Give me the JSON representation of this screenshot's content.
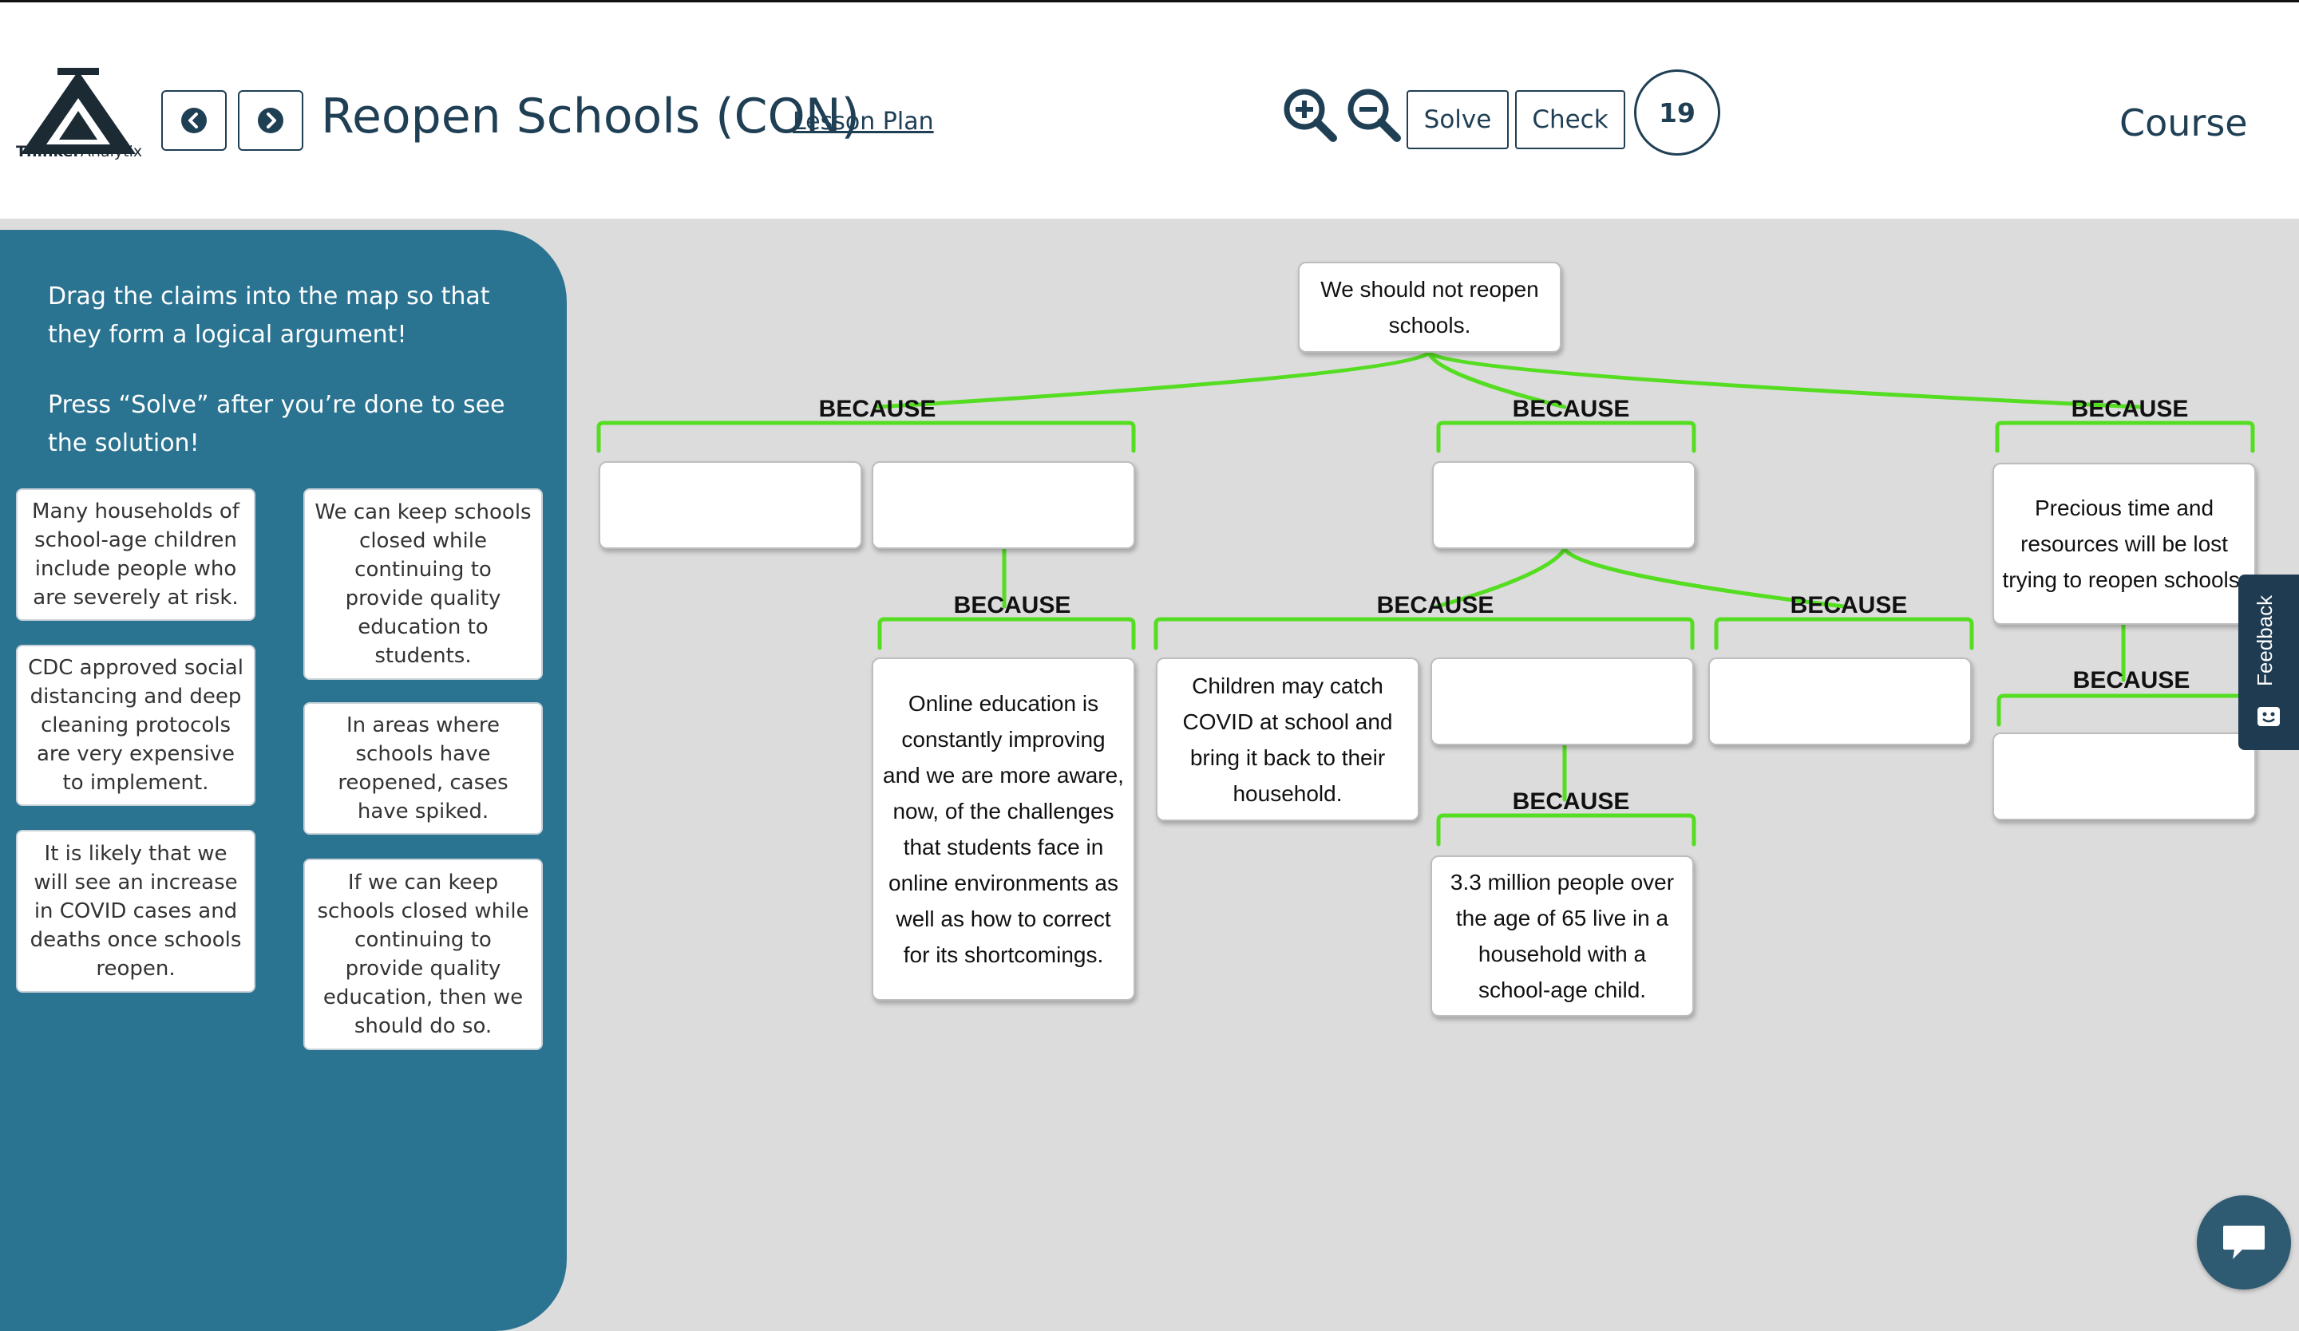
{
  "header": {
    "logo_text_bold": "Thinker",
    "logo_text_rest": "Analytix",
    "title": "Reopen Schools (CON)",
    "lesson_plan_link": "Lesson Plan",
    "solve_label": "Solve",
    "check_label": "Check",
    "timer_value": "19",
    "course_label": "Course",
    "icons": [
      "back-arrow-icon",
      "forward-arrow-icon",
      "zoom-in-icon",
      "zoom-out-icon"
    ]
  },
  "sidebar": {
    "instruction_1": "Drag the claims into the map so that they form a logical argument!",
    "instruction_2": "Press “Solve” after you’re done to see the solution!",
    "claims": [
      "Many households of school-age children include people who are severely at risk.",
      "CDC approved social distancing and deep cleaning protocols are very expensive to implement.",
      "It is likely that we will see an increase in COVID cases and deaths once schools reopen.",
      "We can keep schools closed while continuing to provide quality education to students.",
      "In areas where schools have reopened, cases have spiked.",
      "If we can keep schools closed while continuing to provide quality education, then we should do so."
    ]
  },
  "map": {
    "connector_label": "BECAUSE",
    "connector_color": "#55dd22",
    "root": "We should not reopen schools.",
    "online_education": "Online education is constantly improving and we are more aware, now, of the challenges that students face in online environments as well as how to correct for its shortcomings.",
    "children_catch": "Children may catch COVID at school and bring it back to their household.",
    "million_people": "3.3 million people over the age of 65 live in a household with a school-age child.",
    "precious_time": "Precious time and resources will be lost trying to reopen schools."
  },
  "widgets": {
    "feedback_label": "Feedback",
    "chat_icon": "chat-bubble-icon"
  },
  "colors": {
    "sidebar": "#2a7391",
    "navy": "#1f3f55",
    "map_background": "#dcdcdc"
  }
}
